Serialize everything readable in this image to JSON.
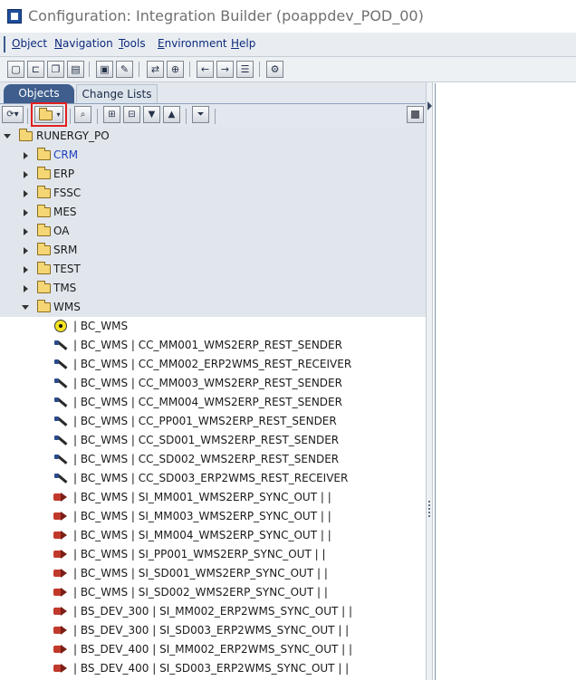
{
  "window": {
    "title": "Configuration: Integration Builder (poappdev_POD_00)"
  },
  "menu": [
    {
      "first": "O",
      "rest": "bject"
    },
    {
      "first": "N",
      "rest": "avigation"
    },
    {
      "first": "T",
      "rest": "ools"
    },
    {
      "first": "E",
      "rest": "nvironment"
    },
    {
      "first": "H",
      "rest": "elp"
    }
  ],
  "toolbar_icons": [
    "new-doc-icon",
    "open-icon",
    "copy-icon",
    "delete-icon",
    "display-icon",
    "edit-icon",
    "navigate-icon",
    "where-used-icon",
    "back-icon",
    "forward-icon",
    "list-icon",
    "settings-icon"
  ],
  "tabs": {
    "objects": "Objects",
    "change_lists": "Change Lists"
  },
  "tree": {
    "root": "RUNERGY_PO",
    "folders": [
      {
        "label": "CRM",
        "color": "#1e3fbf"
      },
      {
        "label": "ERP"
      },
      {
        "label": "FSSC"
      },
      {
        "label": "MES"
      },
      {
        "label": "OA"
      },
      {
        "label": "SRM"
      },
      {
        "label": "TEST"
      },
      {
        "label": "TMS"
      }
    ],
    "expanded_folder": "WMS",
    "items": [
      {
        "icon": "business-component-icon",
        "label": "| BC_WMS"
      },
      {
        "icon": "communication-channel-icon",
        "label": "| BC_WMS | CC_MM001_WMS2ERP_REST_SENDER"
      },
      {
        "icon": "communication-channel-icon",
        "label": "| BC_WMS | CC_MM002_ERP2WMS_REST_RECEIVER"
      },
      {
        "icon": "communication-channel-icon",
        "label": "| BC_WMS | CC_MM003_WMS2ERP_REST_SENDER"
      },
      {
        "icon": "communication-channel-icon",
        "label": "| BC_WMS | CC_MM004_WMS2ERP_REST_SENDER"
      },
      {
        "icon": "communication-channel-icon",
        "label": "| BC_WMS | CC_PP001_WMS2ERP_REST_SENDER"
      },
      {
        "icon": "communication-channel-icon",
        "label": "| BC_WMS | CC_SD001_WMS2ERP_REST_SENDER"
      },
      {
        "icon": "communication-channel-icon",
        "label": "| BC_WMS | CC_SD002_WMS2ERP_REST_SENDER"
      },
      {
        "icon": "communication-channel-icon",
        "label": "| BC_WMS | CC_SD003_ERP2WMS_REST_RECEIVER"
      },
      {
        "icon": "sender-agreement-icon",
        "label": "| BC_WMS | SI_MM001_WMS2ERP_SYNC_OUT | |"
      },
      {
        "icon": "sender-agreement-icon",
        "label": "| BC_WMS | SI_MM003_WMS2ERP_SYNC_OUT | |"
      },
      {
        "icon": "sender-agreement-icon",
        "label": "| BC_WMS | SI_MM004_WMS2ERP_SYNC_OUT | |"
      },
      {
        "icon": "sender-agreement-icon",
        "label": "| BC_WMS | SI_PP001_WMS2ERP_SYNC_OUT | |"
      },
      {
        "icon": "sender-agreement-icon",
        "label": "| BC_WMS | SI_SD001_WMS2ERP_SYNC_OUT | |"
      },
      {
        "icon": "sender-agreement-icon",
        "label": "| BC_WMS | SI_SD002_WMS2ERP_SYNC_OUT | |"
      },
      {
        "icon": "sender-agreement-icon",
        "label": "| BS_DEV_300 | SI_MM002_ERP2WMS_SYNC_OUT | |"
      },
      {
        "icon": "sender-agreement-icon",
        "label": "| BS_DEV_300 | SI_SD003_ERP2WMS_SYNC_OUT | |"
      },
      {
        "icon": "sender-agreement-icon",
        "label": "| BS_DEV_400 | SI_MM002_ERP2WMS_SYNC_OUT | |"
      },
      {
        "icon": "sender-agreement-icon",
        "label": "| BS_DEV_400 | SI_SD003_ERP2WMS_SYNC_OUT | |"
      }
    ]
  }
}
